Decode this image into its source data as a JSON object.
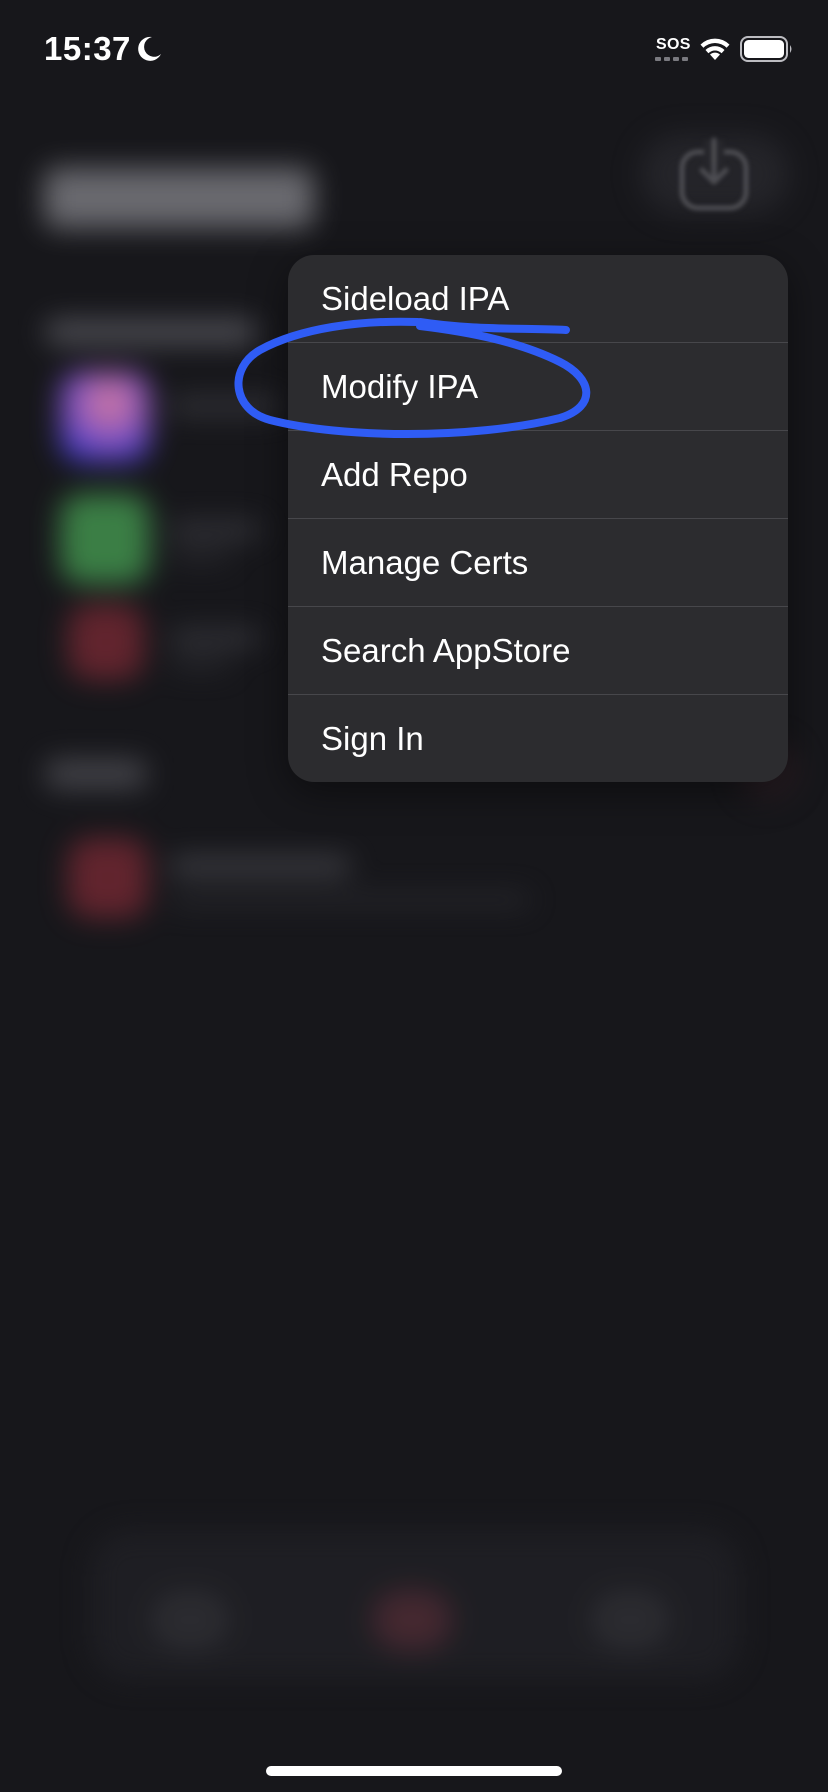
{
  "status_bar": {
    "time": "15:37",
    "carrier": "SOS",
    "icons": [
      "moon-icon",
      "wifi-icon",
      "battery-icon"
    ]
  },
  "menu": {
    "items": [
      {
        "label": "Sideload IPA"
      },
      {
        "label": "Modify IPA"
      },
      {
        "label": "Add Repo"
      },
      {
        "label": "Manage Certs"
      },
      {
        "label": "Search AppStore"
      },
      {
        "label": "Sign In"
      }
    ],
    "background_color": "#2c2c2f"
  },
  "annotation": {
    "color": "#2f5cf5",
    "target": "Modify IPA"
  },
  "background": {
    "download_icon": "download-icon"
  }
}
